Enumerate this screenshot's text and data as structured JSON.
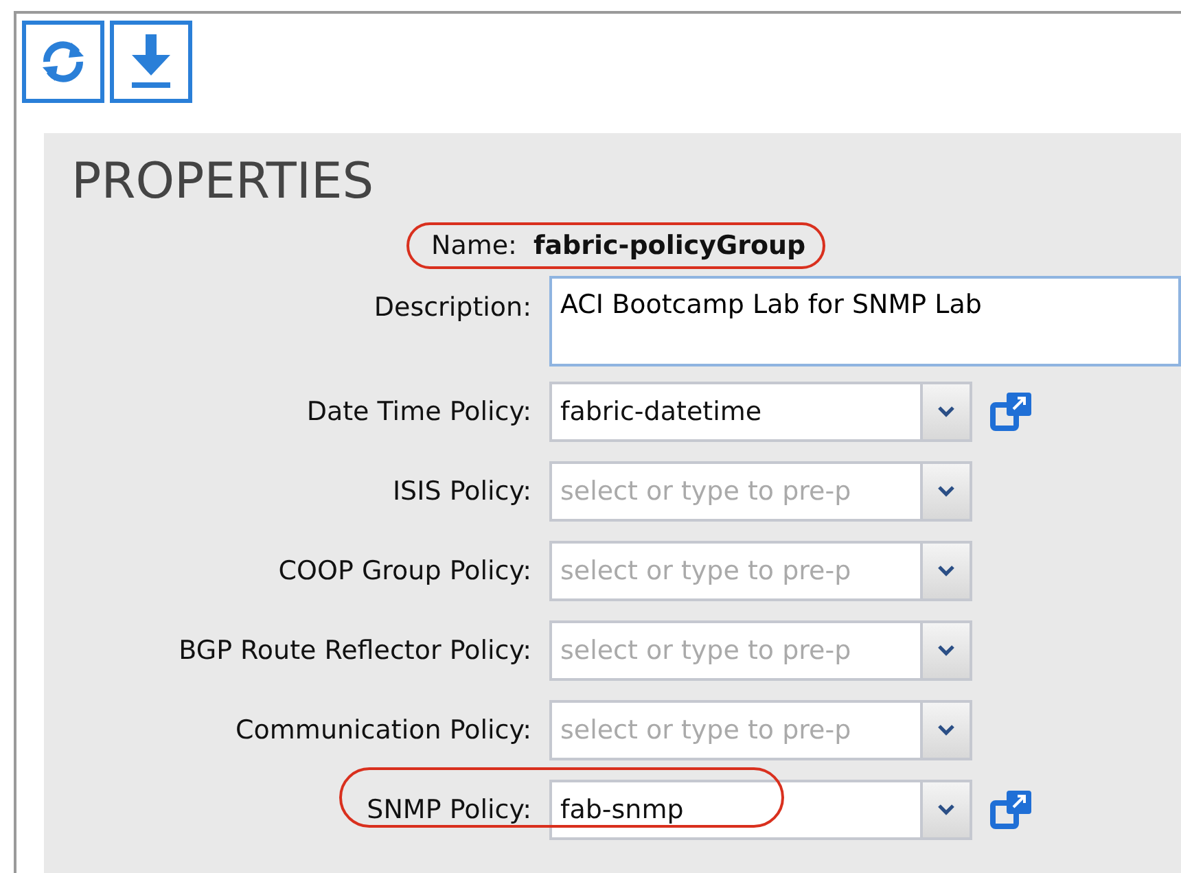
{
  "toolbar": {
    "buttons": [
      {
        "kind": "refresh"
      },
      {
        "kind": "download"
      }
    ]
  },
  "properties": {
    "title": "PROPERTIES",
    "name": {
      "label": "Name:",
      "value": "fabric-policyGroup",
      "highlighted": true
    },
    "description": {
      "label": "Description:",
      "value": "ACI Bootcamp Lab for SNMP Lab"
    },
    "fields": [
      {
        "label": "Date Time Policy:",
        "value": "fabric-datetime",
        "open_button": true,
        "highlighted": false
      },
      {
        "label": "ISIS Policy:",
        "placeholder": "select or type to pre-p",
        "open_button": false,
        "highlighted": false
      },
      {
        "label": "COOP Group Policy:",
        "placeholder": "select or type to pre-p",
        "open_button": false,
        "highlighted": false
      },
      {
        "label": "BGP Route Reflector Policy:",
        "placeholder": "select or type to pre-p",
        "open_button": false,
        "highlighted": false
      },
      {
        "label": "Communication Policy:",
        "placeholder": "select or type to pre-p",
        "open_button": false,
        "highlighted": false
      },
      {
        "label": "SNMP Policy:",
        "value": "fab-snmp",
        "open_button": true,
        "highlighted": true
      }
    ]
  }
}
